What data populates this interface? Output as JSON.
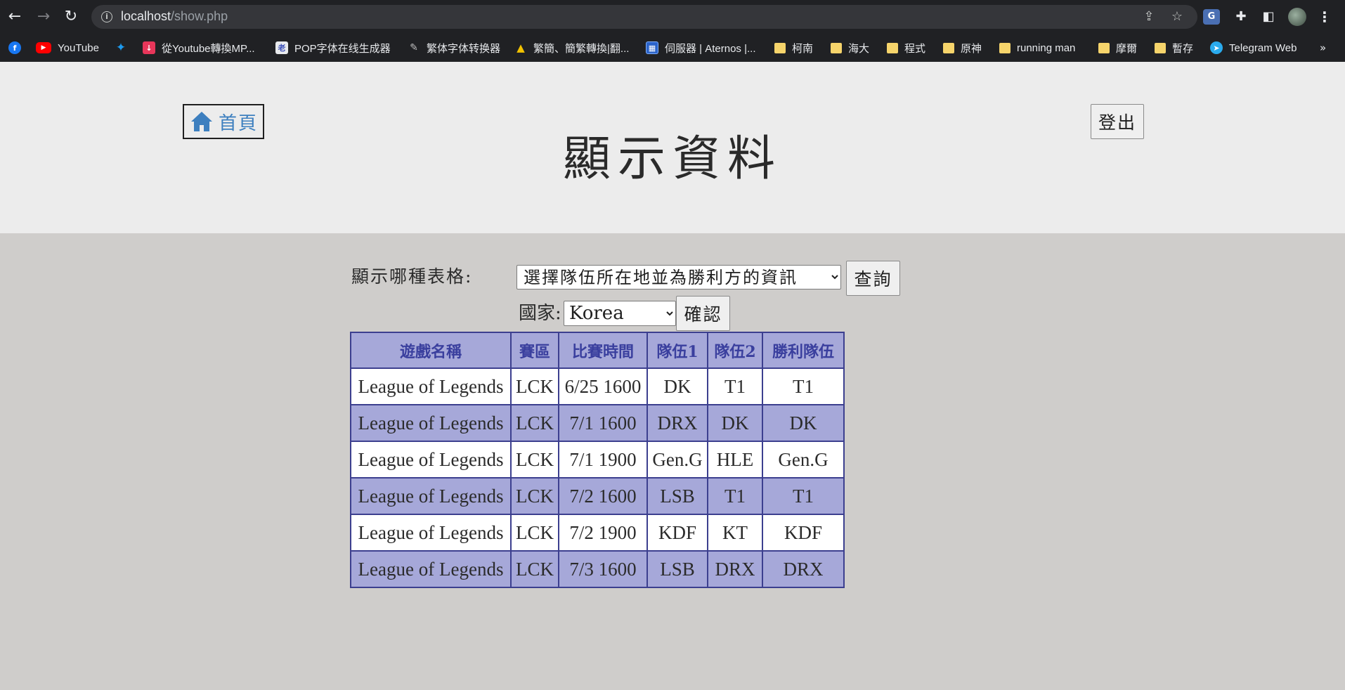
{
  "browser": {
    "url_host": "localhost",
    "url_path": "/show.php",
    "bookmarks": [
      {
        "label": "",
        "icon": "facebook-icon"
      },
      {
        "label": "YouTube",
        "icon": "youtube-icon"
      },
      {
        "label": "",
        "icon": "twitter-icon"
      },
      {
        "label": "從Youtube轉換MP...",
        "icon": "download-icon"
      },
      {
        "label": "POP字体在线生成器",
        "icon": "pop-font-icon"
      },
      {
        "label": "繁体字体转换器",
        "icon": "font-converter-icon"
      },
      {
        "label": "繁簡、簡繁轉換|翻...",
        "icon": "penguin-icon"
      },
      {
        "label": "伺服器 | Aternos |...",
        "icon": "aternos-icon"
      },
      {
        "label": "柯南",
        "icon": "folder-icon"
      },
      {
        "label": "海大",
        "icon": "folder-icon"
      },
      {
        "label": "程式",
        "icon": "folder-icon"
      },
      {
        "label": "原神",
        "icon": "folder-icon"
      },
      {
        "label": "running man",
        "icon": "folder-icon"
      },
      {
        "label": "摩爾",
        "icon": "folder-icon"
      },
      {
        "label": "暫存",
        "icon": "folder-icon"
      },
      {
        "label": "Telegram Web",
        "icon": "telegram-icon"
      }
    ],
    "more_label": "»"
  },
  "header": {
    "home_label": "首頁",
    "title": "顯示資料",
    "logout_label": "登出"
  },
  "form": {
    "table_label": "顯示哪種表格:",
    "table_select_value": "選擇隊伍所在地並為勝利方的資訊",
    "query_label": "查詢",
    "country_label": "國家:",
    "country_value": "Korea",
    "confirm_label": "確認"
  },
  "table": {
    "headers": [
      "遊戲名稱",
      "賽區",
      "比賽時間",
      "隊伍1",
      "隊伍2",
      "勝利隊伍"
    ],
    "rows": [
      [
        "League of Legends",
        "LCK",
        "6/25 1600",
        "DK",
        "T1",
        "T1"
      ],
      [
        "League of Legends",
        "LCK",
        "7/1 1600",
        "DRX",
        "DK",
        "DK"
      ],
      [
        "League of Legends",
        "LCK",
        "7/1 1900",
        "Gen.G",
        "HLE",
        "Gen.G"
      ],
      [
        "League of Legends",
        "LCK",
        "7/2 1600",
        "LSB",
        "T1",
        "T1"
      ],
      [
        "League of Legends",
        "LCK",
        "7/2 1900",
        "KDF",
        "KT",
        "KDF"
      ],
      [
        "League of Legends",
        "LCK",
        "7/3 1600",
        "LSB",
        "DRX",
        "DRX"
      ]
    ]
  },
  "colors": {
    "header_bg": "#ececec",
    "page_bg": "#cfcdcb",
    "table_header_bg": "#a6a8d9",
    "table_header_text": "#3a3f9e",
    "table_border": "#3c3f8f",
    "home_link_color": "#3d7fbf"
  }
}
